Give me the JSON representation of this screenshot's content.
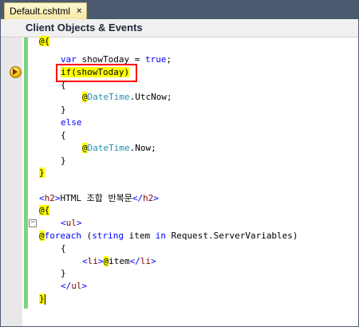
{
  "tab": {
    "label": "Default.cshtml",
    "close": "×"
  },
  "header": {
    "title": "Client Objects & Events"
  },
  "code": [
    {
      "tokens": [
        {
          "t": "@{",
          "c": "razor"
        }
      ]
    },
    {
      "tokens": [
        {
          "t": "var",
          "c": "kw"
        },
        {
          "t": " showToday = ",
          "c": "plain"
        },
        {
          "t": "true",
          "c": "kw"
        },
        {
          "t": ";",
          "c": "plain"
        }
      ]
    },
    {
      "tokens": [
        {
          "t": "if",
          "c": "razor"
        },
        {
          "t": "(showToday)",
          "c": "razor"
        }
      ]
    },
    {
      "tokens": [
        {
          "t": "{",
          "c": "plain"
        }
      ]
    },
    {
      "tokens": [
        {
          "t": "@",
          "c": "razor"
        },
        {
          "t": "DateTime",
          "c": "type"
        },
        {
          "t": ".UtcNow;",
          "c": "plain"
        }
      ]
    },
    {
      "tokens": [
        {
          "t": "}",
          "c": "plain"
        }
      ]
    },
    {
      "tokens": [
        {
          "t": "else",
          "c": "kw"
        }
      ]
    },
    {
      "tokens": [
        {
          "t": "{",
          "c": "plain"
        }
      ]
    },
    {
      "tokens": [
        {
          "t": "@",
          "c": "razor"
        },
        {
          "t": "DateTime",
          "c": "type"
        },
        {
          "t": ".Now;",
          "c": "plain"
        }
      ]
    },
    {
      "tokens": [
        {
          "t": "}",
          "c": "plain"
        }
      ]
    },
    {
      "tokens": [
        {
          "t": "}",
          "c": "razor"
        }
      ]
    },
    {
      "tokens": []
    },
    {
      "tokens": [
        {
          "t": "<",
          "c": "tagbr"
        },
        {
          "t": "h2",
          "c": "tag"
        },
        {
          "t": ">",
          "c": "tagbr"
        },
        {
          "t": "HTML 조합 반복문",
          "c": "plain"
        },
        {
          "t": "</",
          "c": "tagbr"
        },
        {
          "t": "h2",
          "c": "tag"
        },
        {
          "t": ">",
          "c": "tagbr"
        }
      ]
    },
    {
      "tokens": [
        {
          "t": "@{",
          "c": "razor"
        }
      ]
    },
    {
      "tokens": [
        {
          "t": "<",
          "c": "tagbr"
        },
        {
          "t": "ul",
          "c": "tag"
        },
        {
          "t": ">",
          "c": "tagbr"
        }
      ]
    },
    {
      "tokens": [
        {
          "t": "@",
          "c": "razor"
        },
        {
          "t": "foreach",
          "c": "kw"
        },
        {
          "t": " (",
          "c": "plain"
        },
        {
          "t": "string",
          "c": "kw"
        },
        {
          "t": " item ",
          "c": "plain"
        },
        {
          "t": "in",
          "c": "kw"
        },
        {
          "t": " Request.ServerVariables)",
          "c": "plain"
        }
      ]
    },
    {
      "tokens": [
        {
          "t": "{",
          "c": "plain"
        }
      ]
    },
    {
      "tokens": [
        {
          "t": "<",
          "c": "tagbr"
        },
        {
          "t": "li",
          "c": "tag"
        },
        {
          "t": ">",
          "c": "tagbr"
        },
        {
          "t": "@",
          "c": "razor"
        },
        {
          "t": "item",
          "c": "plain"
        },
        {
          "t": "</",
          "c": "tagbr"
        },
        {
          "t": "li",
          "c": "tag"
        },
        {
          "t": ">",
          "c": "tagbr"
        }
      ]
    },
    {
      "tokens": [
        {
          "t": "}",
          "c": "plain"
        }
      ]
    },
    {
      "tokens": [
        {
          "t": "</",
          "c": "tagbr"
        },
        {
          "t": "ul",
          "c": "tag"
        },
        {
          "t": ">",
          "c": "tagbr"
        }
      ]
    },
    {
      "tokens": [
        {
          "t": "}",
          "c": "razor"
        }
      ]
    }
  ]
}
